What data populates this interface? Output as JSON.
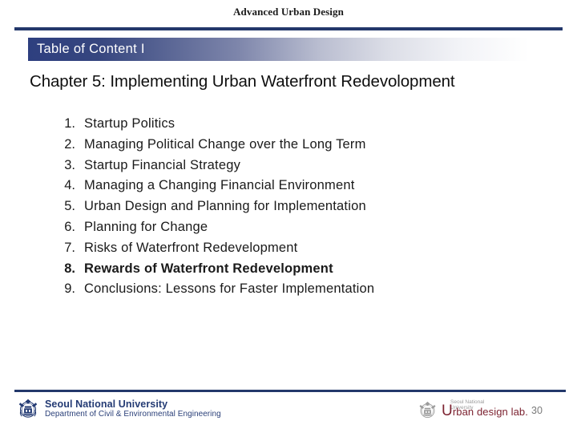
{
  "header": {
    "course_title": "Advanced Urban Design",
    "section_banner": "Table of Content I",
    "accent_color": "#23386b"
  },
  "main": {
    "chapter_heading": "Chapter 5: Implementing Urban Waterfront Redevolopment",
    "toc": [
      {
        "number": "1.",
        "label": "Startup Politics",
        "current": false
      },
      {
        "number": "2.",
        "label": "Managing Political Change over the Long Term",
        "current": false
      },
      {
        "number": "3.",
        "label": "Startup Financial Strategy",
        "current": false
      },
      {
        "number": "4.",
        "label": "Managing a Changing Financial Environment",
        "current": false
      },
      {
        "number": "5.",
        "label": "Urban Design and Planning for Implementation",
        "current": false
      },
      {
        "number": "6.",
        "label": "Planning for Change",
        "current": false
      },
      {
        "number": "7.",
        "label": "Risks of Waterfront Redevelopment",
        "current": false
      },
      {
        "number": "8.",
        "label": "Rewards of Waterfront Redevelopment",
        "current": true
      },
      {
        "number": "9.",
        "label": "Conclusions: Lessons for Faster Implementation",
        "current": false
      }
    ]
  },
  "footer": {
    "university": "Seoul National University",
    "department": "Department of Civil & Environmental Engineering",
    "university_color": "#243b74",
    "lab": {
      "sub_line1": "Seoul National",
      "sub_line2": "University",
      "name_cap": "U",
      "name_rest": "rban design lab.",
      "color": "#7c2230"
    },
    "page_number": "30"
  }
}
